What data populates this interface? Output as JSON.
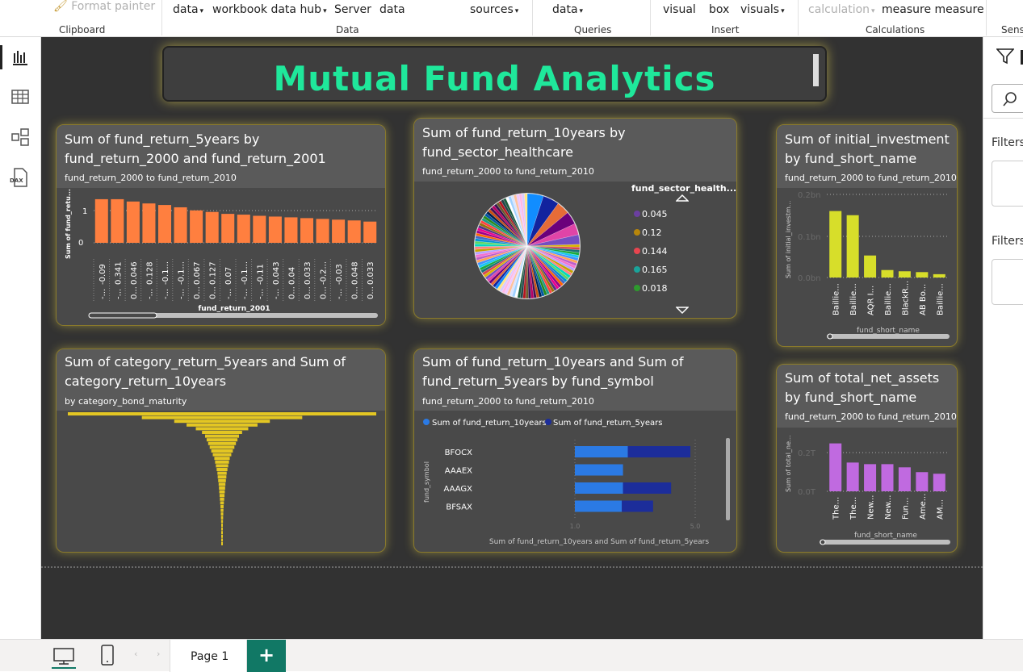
{
  "ribbon": {
    "format_painter": "Format painter",
    "clipboard_group": "Clipboard",
    "data_items": [
      "data",
      "workbook data hub",
      "Server",
      "data",
      "sources"
    ],
    "data_group": "Data",
    "queries_item": "data",
    "queries_group": "Queries",
    "insert_items": [
      "visual",
      "box",
      "visuals"
    ],
    "insert_group": "Insert",
    "calc_items": [
      "calculation",
      "measure measure"
    ],
    "calc_group": "Calculations",
    "sens_group": "Sensi"
  },
  "report": {
    "title": "Mutual Fund Analytics"
  },
  "colors": {
    "title": "#1fe89b",
    "orange": "#ff7f3f",
    "yellow": "#e3c623",
    "lime": "#d7de2a",
    "purple": "#c06ae0",
    "blue_light": "#2b7ae4",
    "blue_dark": "#1c2d9a"
  },
  "visual1": {
    "title_line1": "Sum of fund_return_5years by",
    "title_line2": "fund_return_2000 and fund_return_2001",
    "subtitle": "fund_return_2000 to fund_return_2010",
    "ylabel": "Sum of fund_retu...",
    "xlabel": "fund_return_2001",
    "yticks": [
      "1",
      "0"
    ],
    "x_top_labels": [
      "-0.09",
      "0.341",
      "0.046",
      "0.128",
      "-0.1...",
      "-0.1...",
      "0.067",
      "0.127",
      "0.07",
      "-0.1...",
      "-0.11",
      "0.043",
      "0.04",
      "0.033",
      "-0.2...",
      "-0.03",
      "0.048",
      "0.033"
    ],
    "x_bottom_labels": [
      "-...",
      "-...",
      "0...",
      "-...",
      "-...",
      "-...",
      "0...",
      "0...",
      "-...",
      "-...",
      "-...",
      "-...",
      "0...",
      "0...",
      "0...",
      "-...",
      "0...",
      "0..."
    ]
  },
  "visual2": {
    "title_line1": "Sum of fund_return_10years by",
    "title_line2": "fund_sector_healthcare",
    "subtitle": "fund_return_2000 to fund_return_2010",
    "legend_title": "fund_sector_health...",
    "legend": [
      {
        "label": "0.045",
        "color": "#6b3fa0"
      },
      {
        "label": "0.12",
        "color": "#b8860b"
      },
      {
        "label": "0.144",
        "color": "#e8454f"
      },
      {
        "label": "0.165",
        "color": "#1aa39a"
      },
      {
        "label": "0.018",
        "color": "#2e9a2e"
      }
    ]
  },
  "visual3": {
    "title_line1": "Sum of initial_investment",
    "title_line2": "by fund_short_name",
    "subtitle": "fund_return_2000 to fund_return_2010",
    "ylabel": "Sum of initial_investm...",
    "xlabel": "fund_short_name",
    "yticks": [
      "0.2bn",
      "0.1bn",
      "0.0bn"
    ],
    "categories": [
      "Baillie...",
      "Baillie...",
      "AQR I...",
      "Baillie...",
      "BlackR...",
      "AB Bo...",
      "Baillie..."
    ]
  },
  "visual4": {
    "title_line1": "Sum of total_net_assets",
    "title_line2": "by fund_short_name",
    "subtitle": "fund_return_2000 to fund_return_2010",
    "ylabel": "Sum of total_ne...",
    "xlabel": "fund_short_name",
    "yticks": [
      "0.2T",
      "0.0T"
    ],
    "categories": [
      "The...",
      "The...",
      "New...",
      "New...",
      "Fun...",
      "Ame...",
      "AM..."
    ]
  },
  "visual5": {
    "title_line1": "Sum of category_return_5years and Sum of",
    "title_line2": "category_return_10years",
    "subtitle": "by category_bond_maturity"
  },
  "visual6": {
    "title_line1": "Sum of fund_return_10years and Sum of",
    "title_line2": "fund_return_5years by fund_symbol",
    "subtitle": "fund_return_2000 to fund_return_2010",
    "legend": [
      "Sum of fund_return_10years",
      "Sum of fund_return_5years"
    ],
    "ylabel": "fund_symbol",
    "xlabel": "Sum of fund_return_10years and Sum of fund_return_5years",
    "xticks": [
      "1.0",
      "5.0"
    ]
  },
  "chart_data": [
    {
      "type": "bar",
      "title": "Sum of fund_return_5years by fund_return_2000 and fund_return_2001",
      "xlabel": "fund_return_2001",
      "ylabel": "Sum of fund_retu...",
      "values": [
        1.13,
        1.13,
        1.07,
        1.02,
        0.98,
        0.92,
        0.84,
        0.8,
        0.75,
        0.73,
        0.7,
        0.68,
        0.66,
        0.64,
        0.62,
        0.6,
        0.58,
        0.55
      ],
      "ylim": [
        0,
        1.4
      ]
    },
    {
      "type": "pie",
      "title": "Sum of fund_return_10years by fund_sector_healthcare",
      "labels": [
        "0.045",
        "0.12",
        "0.144",
        "0.165",
        "0.018"
      ]
    },
    {
      "type": "bar",
      "title": "Sum of initial_investment by fund_short_name",
      "categories": [
        "Baillie...",
        "Baillie...",
        "AQR I...",
        "Baillie...",
        "BlackR...",
        "AB Bo...",
        "Baillie..."
      ],
      "values": [
        0.16,
        0.15,
        0.053,
        0.018,
        0.015,
        0.013,
        0.008
      ],
      "ylim": [
        0,
        0.2
      ]
    },
    {
      "type": "bar",
      "title": "Sum of total_net_assets by fund_short_name",
      "categories": [
        "The...",
        "The...",
        "New...",
        "New...",
        "Fun...",
        "Ame...",
        "AM..."
      ],
      "values": [
        0.3,
        0.18,
        0.17,
        0.17,
        0.15,
        0.12,
        0.11
      ],
      "ylim": [
        0,
        0.4
      ]
    },
    {
      "type": "bar",
      "title": "Sum of category_return_5years and Sum of category_return_10years by category_bond_maturity",
      "orientation": "horizontal-funnel",
      "values": [
        1.0,
        0.52,
        0.31,
        0.23,
        0.17,
        0.13,
        0.11,
        0.1,
        0.09,
        0.08,
        0.07,
        0.06,
        0.05,
        0.045,
        0.04,
        0.035,
        0.03,
        0.028,
        0.025,
        0.022,
        0.02,
        0.018,
        0.016,
        0.014,
        0.012,
        0.01,
        0.009,
        0.008,
        0.007,
        0.006,
        0.005,
        0.004,
        0.003,
        0.002,
        0.002,
        0.001
      ]
    },
    {
      "type": "bar",
      "orientation": "horizontal-stacked",
      "title": "Sum of fund_return_10years and Sum of fund_return_5years by fund_symbol",
      "categories": [
        "BFOCX",
        "AAAEX",
        "AAAGX",
        "BFSAX"
      ],
      "series": [
        {
          "name": "Sum of fund_return_10years",
          "values": [
            2.2,
            2.0,
            2.0,
            1.95
          ]
        },
        {
          "name": "Sum of fund_return_5years",
          "values": [
            2.6,
            0.0,
            2.0,
            1.3
          ]
        }
      ],
      "xlim": [
        0,
        5.0
      ]
    }
  ],
  "left_nav": {
    "dax_label": "DAX"
  },
  "right_pane": {
    "filters1": "Filters",
    "filters2": "Filters"
  },
  "bottom": {
    "page_tab": "Page 1",
    "add_page": "+"
  }
}
